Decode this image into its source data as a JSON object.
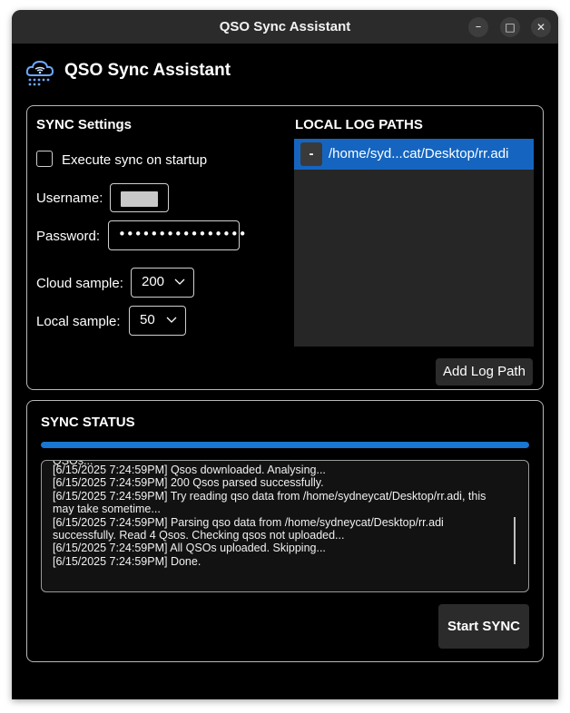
{
  "window": {
    "title": "QSO Sync Assistant",
    "controls": {
      "minimize": "–",
      "maximize": "□",
      "close": "✕"
    }
  },
  "header": {
    "title": "QSO Sync Assistant",
    "logo_icon": "cloud-radio-icon"
  },
  "sync_settings": {
    "title": "SYNC Settings",
    "startup_label": "Execute sync on startup",
    "startup_checked": false,
    "username_label": "Username:",
    "password_label": "Password:",
    "password_value": "••••••••••••••••",
    "cloud_sample_label": "Cloud sample:",
    "cloud_sample_value": "200",
    "local_sample_label": "Local sample:",
    "local_sample_value": "50"
  },
  "log_paths": {
    "title": "LOCAL LOG PATHS",
    "items": [
      {
        "remove_label": "-",
        "path": "/home/syd...cat/Desktop/rr.adi"
      }
    ],
    "add_label": "Add Log Path"
  },
  "sync_status": {
    "title": "SYNC STATUS",
    "progress": 1.0,
    "partial_line": "QSOs...",
    "log_lines": [
      "[6/15/2025 7:24:59PM] Qsos downloaded. Analysing...",
      "[6/15/2025 7:24:59PM] 200 Qsos parsed successfully.",
      "[6/15/2025 7:24:59PM] Try reading qso data from /home/sydneycat/Desktop/rr.adi, this may take sometime...",
      "[6/15/2025 7:24:59PM] Parsing qso data from /home/sydneycat/Desktop/rr.adi successfully. Read 4 Qsos. Checking qsos not uploaded...",
      "[6/15/2025 7:24:59PM] All QSOs uploaded. Skipping...",
      "[6/15/2025 7:24:59PM] Done."
    ],
    "start_label": "Start SYNC"
  },
  "colors": {
    "background": "#000000",
    "titlebar": "#2b2b2b",
    "accent": "#1976d2",
    "selected_row": "#1565c0",
    "button": "#2b2b2b"
  }
}
